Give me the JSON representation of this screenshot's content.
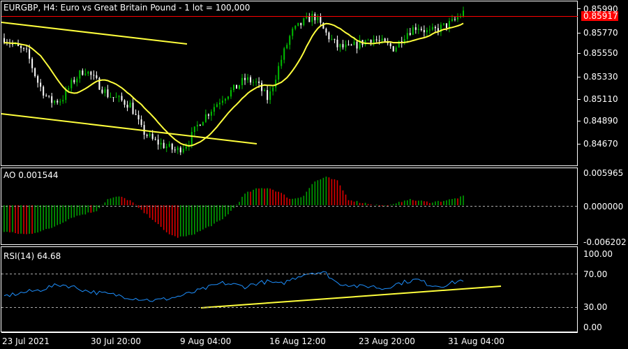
{
  "chart": {
    "title": "EURGBP, H4:  Euro vs Great Britain Pound - 1 lot = 100,000",
    "symbol": "EURGBP",
    "timeframe": "H4",
    "current_price_label": "0.85917",
    "price_ticks": [
      "0.85990",
      "0.85770",
      "0.85550",
      "0.85330",
      "0.85110",
      "0.84890",
      "0.84670"
    ],
    "time_labels": [
      "23 Jul 2021",
      "30 Jul 20:00",
      "9 Aug 04:00",
      "16 Aug 12:00",
      "23 Aug 20:00",
      "31 Aug 04:00"
    ]
  },
  "ao": {
    "label": "AO 0.001544",
    "ticks": [
      "0.005965",
      "0.000000",
      "-0.006202"
    ]
  },
  "rsi": {
    "label": "RSI(14) 64.68",
    "ticks": [
      "100.00",
      "70.00",
      "30.00",
      "0.00"
    ]
  },
  "colors": {
    "background": "#000000",
    "bull_candle": "#00c000",
    "bear_candle": "#ffffff",
    "ma_line": "#ffff3c",
    "trendline": "#ffff3c",
    "price_line": "#ff0000",
    "ao_up": "#00a000",
    "ao_down": "#e00000",
    "rsi_line": "#1e90ff",
    "grid": "#aaaaaa",
    "axis_text": "#ffffff"
  },
  "chart_data": [
    {
      "type": "candlestick",
      "title": "EURGBP, H4:  Euro vs Great Britain Pound - 1 lot = 100,000",
      "x": [
        "23 Jul 2021",
        "30 Jul 20:00",
        "9 Aug 04:00",
        "16 Aug 12:00",
        "23 Aug 20:00",
        "31 Aug 04:00"
      ],
      "close": [
        0.857,
        0.8562,
        0.8555,
        0.8525,
        0.8508,
        0.851,
        0.8528,
        0.854,
        0.8528,
        0.8515,
        0.851,
        0.8505,
        0.848,
        0.847,
        0.8465,
        0.846,
        0.8468,
        0.8488,
        0.85,
        0.8512,
        0.852,
        0.853,
        0.8526,
        0.851,
        0.8545,
        0.8575,
        0.8585,
        0.8592,
        0.8575,
        0.8562,
        0.856,
        0.8565,
        0.857,
        0.8565,
        0.856,
        0.8575,
        0.8582,
        0.8575,
        0.858,
        0.8585,
        0.8595
      ],
      "moving_average_last": 0.8576,
      "current_price": 0.85917,
      "ylim": [
        0.8458,
        0.8603
      ]
    },
    {
      "type": "bar",
      "title": "AO 0.001544",
      "values": [
        -0.0045,
        -0.0048,
        -0.005,
        -0.0045,
        -0.004,
        -0.003,
        -0.002,
        -0.0015,
        -0.001,
        0.001,
        0.0015,
        0.0008,
        -0.001,
        -0.0025,
        -0.0045,
        -0.0055,
        -0.0053,
        -0.0045,
        -0.0035,
        -0.0025,
        -0.0005,
        0.002,
        0.0028,
        0.003,
        0.0022,
        0.001,
        0.0015,
        0.004,
        0.0048,
        0.0042,
        0.001,
        0.0005,
        0.0002,
        -0.0002,
        0.0001,
        0.001,
        0.0008,
        0.0005,
        0.0007,
        0.001,
        0.0015
      ],
      "ylim": [
        -0.006202,
        0.005965
      ]
    },
    {
      "type": "line",
      "title": "RSI(14) 64.68",
      "values": [
        42,
        45,
        48,
        50,
        55,
        58,
        55,
        50,
        47,
        45,
        43,
        40,
        38,
        36,
        38,
        41,
        45,
        50,
        55,
        60,
        58,
        55,
        60,
        62,
        58,
        65,
        72,
        75,
        74,
        60,
        58,
        55,
        56,
        52,
        58,
        62,
        65,
        58,
        56,
        60,
        64.68
      ],
      "reference_lines": [
        70,
        30
      ],
      "ylim": [
        0,
        100
      ]
    }
  ]
}
